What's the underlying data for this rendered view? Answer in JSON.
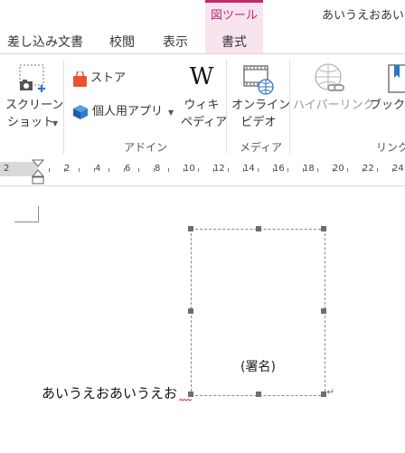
{
  "window": {
    "context_tab_group": "図ツール",
    "document_title": "あいうえおあいう"
  },
  "tabs": {
    "mailings": "差し込み文書",
    "review": "校閲",
    "view": "表示",
    "format": "書式"
  },
  "ribbon": {
    "screenshot_line1": "スクリーン",
    "screenshot_line2": "ショット",
    "store": "ストア",
    "my_apps": "個人用アプリ",
    "wikipedia_line1": "ウィキ",
    "wikipedia_line2": "ペディア",
    "online_video_line1": "オンライン",
    "online_video_line2": "ビデオ",
    "hyperlink": "ハイパーリンク",
    "bookmark": "ブックマ",
    "group_addins": "アドイン",
    "group_media": "メディア",
    "group_links": "リンク"
  },
  "ruler": {
    "ticks": [
      "2",
      "2",
      "4",
      "6",
      "8",
      "10",
      "12",
      "14",
      "16",
      "18",
      "20",
      "22",
      "24"
    ]
  },
  "document": {
    "signature_caption": "(署名)",
    "body_text": "あいうえおあいうえお"
  },
  "colors": {
    "context_accent": "#c2296e",
    "context_band": "#f8e4ef"
  }
}
